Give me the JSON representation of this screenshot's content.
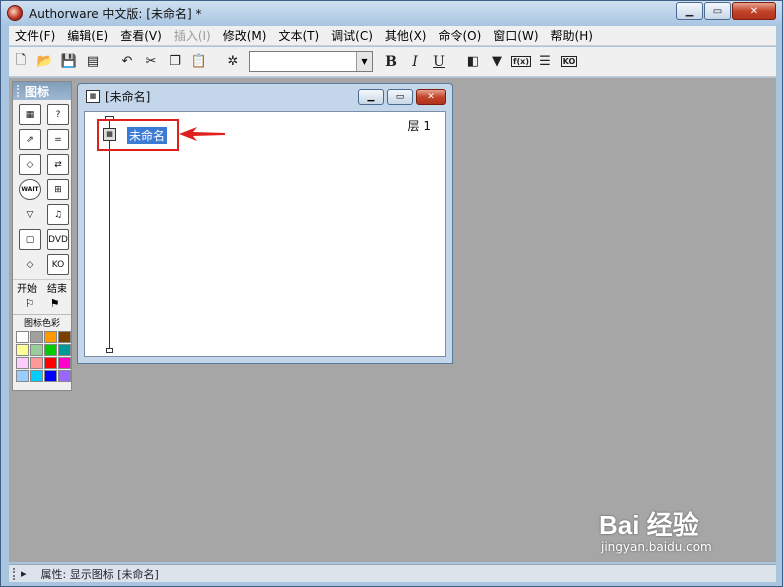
{
  "window": {
    "title": "Authorware 中文版: [未命名] *"
  },
  "menu": [
    {
      "label": "文件(F)",
      "disabled": false
    },
    {
      "label": "编辑(E)",
      "disabled": false
    },
    {
      "label": "查看(V)",
      "disabled": false
    },
    {
      "label": "插入(I)",
      "disabled": true
    },
    {
      "label": "修改(M)",
      "disabled": false
    },
    {
      "label": "文本(T)",
      "disabled": false
    },
    {
      "label": "调试(C)",
      "disabled": false
    },
    {
      "label": "其他(X)",
      "disabled": false
    },
    {
      "label": "命令(O)",
      "disabled": false
    },
    {
      "label": "窗口(W)",
      "disabled": false
    },
    {
      "label": "帮助(H)",
      "disabled": false
    }
  ],
  "toolbar": {
    "font_value": "",
    "bold": "B",
    "italic": "I",
    "underline": "U",
    "fn_label": "f(x)",
    "ko_label": "KO"
  },
  "palette": {
    "title": "图标",
    "start_label": "开始",
    "end_label": "结束",
    "color_label": "图标色彩",
    "wait_label": "WAIT",
    "dvd_label": "DVD",
    "ko_label": "KO",
    "swatches": [
      "#ffffff",
      "#a0a0a0",
      "#ff9a00",
      "#7a4000",
      "#ffff99",
      "#99cc99",
      "#00cc00",
      "#009999",
      "#ffccff",
      "#ff9999",
      "#ff0000",
      "#ff00cc",
      "#99ccff",
      "#00ccff",
      "#0000ff",
      "#9966ff"
    ]
  },
  "design": {
    "title": "[未命名]",
    "layer_label": "层  1",
    "flow_icon_label": "未命名"
  },
  "status": {
    "text": "属性: 显示图标 [未命名]"
  },
  "watermark": {
    "brand": "Bai 经验",
    "url": "jingyan.baidu.com"
  }
}
